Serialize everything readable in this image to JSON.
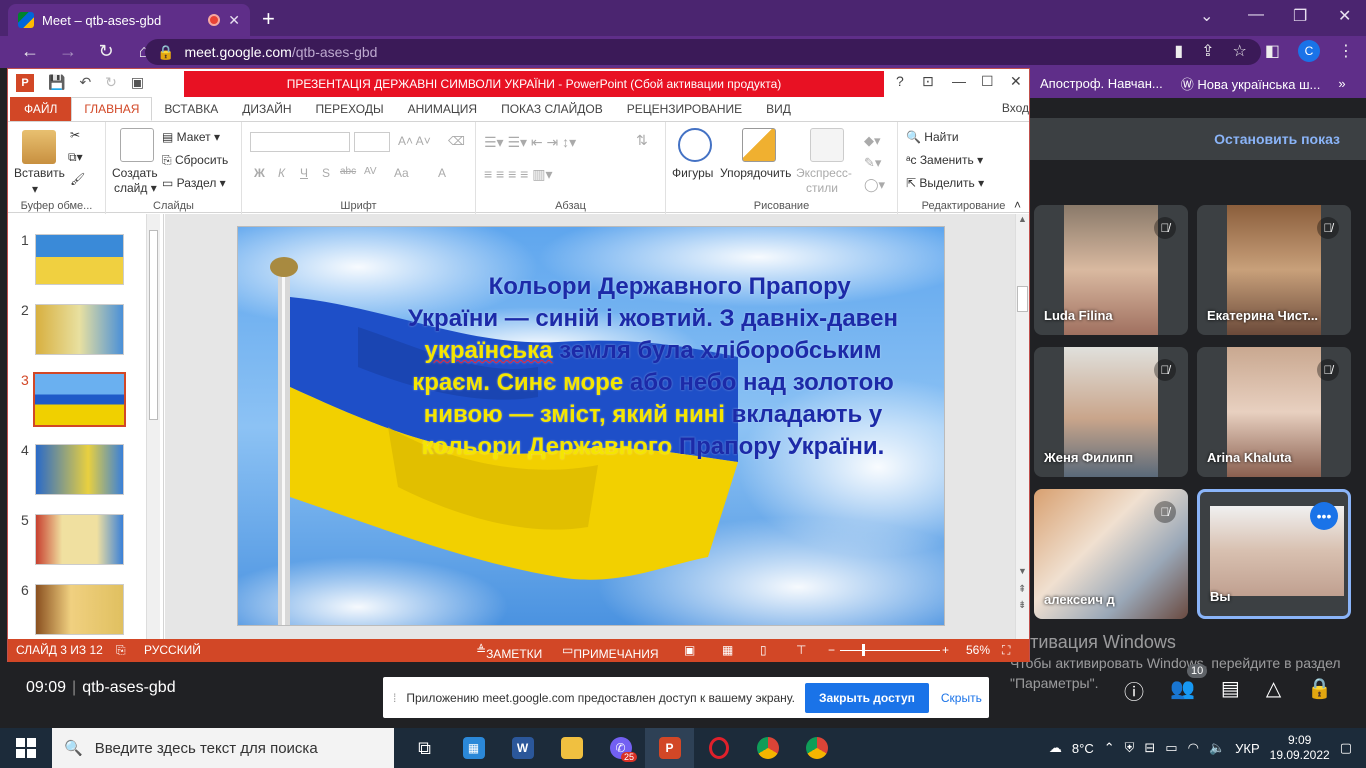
{
  "browser": {
    "tab_title": "Meet – qtb-ases-gbd",
    "url_host": "meet.google.com",
    "url_path": "/qtb-ases-gbd",
    "profile_initial": "C"
  },
  "bookmarks": [
    {
      "label": "Апостроф. Навчан..."
    },
    {
      "label": "Нова українська ш..."
    }
  ],
  "powerpoint": {
    "title": "ПРЕЗЕНТАЦІЯ  ДЕРЖАВНІ СИМВОЛИ УКРАЇНИ -  PowerPoint (Сбой активации продукта)",
    "help": "?",
    "tabs": [
      "ФАЙЛ",
      "ГЛАВНАЯ",
      "ВСТАВКА",
      "ДИЗАЙН",
      "ПЕРЕХОДЫ",
      "АНИМАЦИЯ",
      "ПОКАЗ СЛАЙДОВ",
      "РЕЦЕНЗИРОВАНИЕ",
      "ВИД"
    ],
    "sign_in": "Вход",
    "ribbon": {
      "paste": "Вставить",
      "clipboard_group": "Буфер обме...",
      "new_slide_1": "Создать",
      "new_slide_2": "слайд",
      "layout": "Макет",
      "reset": "Сбросить",
      "section": "Раздел",
      "slides_group": "Слайды",
      "font_group": "Шрифт",
      "font_b": "Ж",
      "font_i": "К",
      "font_u": "Ч",
      "font_s": "S",
      "font_abc": "abc",
      "font_av": "AV",
      "font_aa": "Aa",
      "font_a": "A",
      "paragraph_group": "Абзац",
      "shapes": "Фигуры",
      "arrange": "Упорядочить",
      "quick_styles_1": "Экспресс-",
      "quick_styles_2": "стили",
      "drawing_group": "Рисование",
      "find": "Найти",
      "replace": "Заменить",
      "select": "Выделить",
      "editing_group": "Редактирование"
    },
    "thumbnails": [
      {
        "num": "1"
      },
      {
        "num": "2"
      },
      {
        "num": "3"
      },
      {
        "num": "4"
      },
      {
        "num": "5"
      },
      {
        "num": "6"
      }
    ],
    "slide_text": {
      "p1": "Кольори Державного Прапору",
      "p2": "України — синій і жовтий. З давніх-давен",
      "p3a": "українська",
      "p3b": " земля була хліборобським",
      "p4a": "краєм. Синє море",
      "p4b": " або небо над золотою",
      "p5a": "нивою — зміст, який нині",
      "p5b": " вкладають у",
      "p6a": "кольори Державного",
      "p6b": " Прапору України."
    },
    "status": {
      "slide_of": "СЛАЙД 3 ИЗ 12",
      "language": "РУССКИЙ",
      "notes": "ЗАМЕТКИ",
      "comments": "ПРИМЕЧАНИЯ",
      "zoom": "56%"
    }
  },
  "meet": {
    "stop_presenting": "Остановить показ",
    "participants": [
      {
        "name": "Luda Filina"
      },
      {
        "name": "Екатерина Чист..."
      },
      {
        "name": "Женя Филипп"
      },
      {
        "name": "Arina Khaluta"
      },
      {
        "name": "алексеич д"
      },
      {
        "name": "Вы"
      }
    ],
    "time": "09:09",
    "meeting_code": "qtb-ases-gbd",
    "people_count": "10",
    "share_banner": {
      "text": "Приложению meet.google.com предоставлен доступ к вашему экрану.",
      "close": "Закрыть доступ",
      "hide": "Скрыть"
    }
  },
  "windows": {
    "activation_title": "Активация Windows",
    "activation_text": "Чтобы активировать Windows, перейдите в раздел \"Параметры\".",
    "search_placeholder": "Введите здесь текст для поиска",
    "viber_badge": "25",
    "temperature": "8°C",
    "lang": "УКР",
    "clock_time": "9:09",
    "clock_date": "19.09.2022"
  }
}
